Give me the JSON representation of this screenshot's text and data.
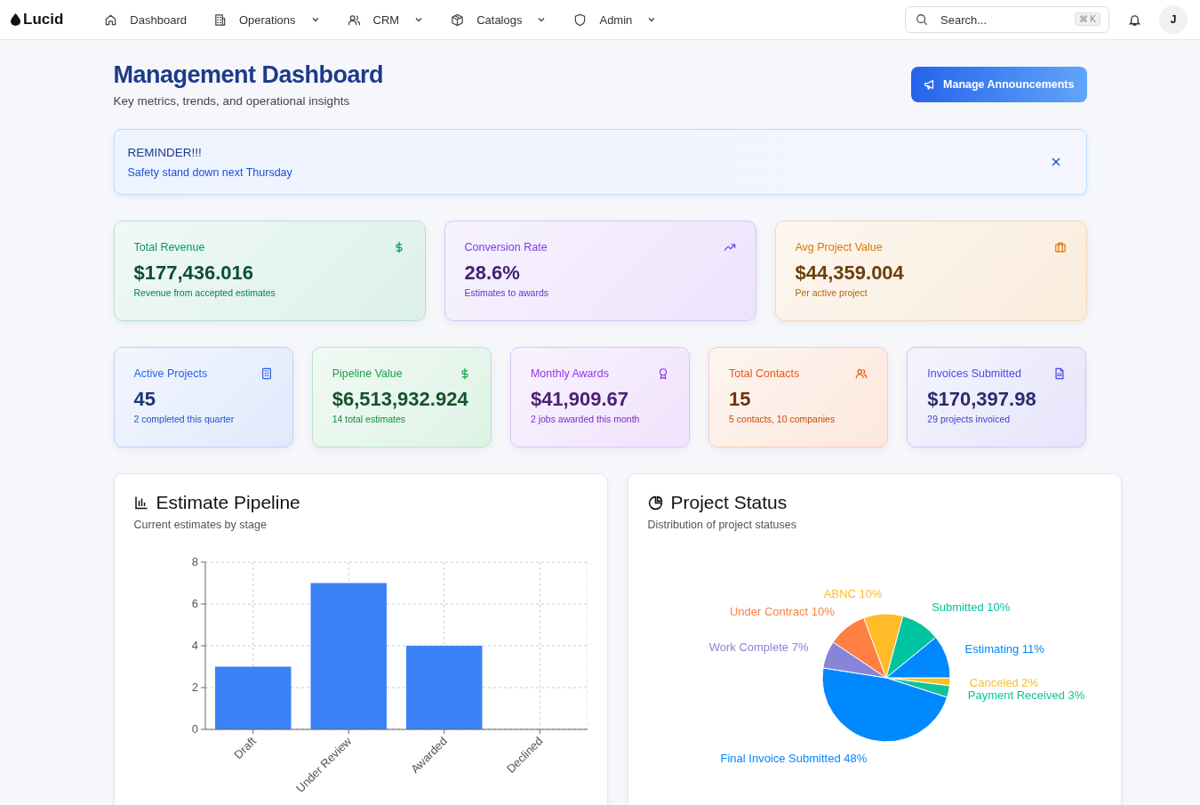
{
  "nav": {
    "logo": "Lucid",
    "items": [
      {
        "label": "Dashboard",
        "dropdown": false
      },
      {
        "label": "Operations",
        "dropdown": true
      },
      {
        "label": "CRM",
        "dropdown": true
      },
      {
        "label": "Catalogs",
        "dropdown": true
      },
      {
        "label": "Admin",
        "dropdown": true
      }
    ],
    "search": {
      "placeholder": "Search...",
      "shortcut": "⌘ K"
    },
    "avatar": "J"
  },
  "header": {
    "title": "Management Dashboard",
    "subtitle": "Key metrics, trends, and operational insights",
    "button": "Manage Announcements"
  },
  "announcement": {
    "title": "REMINDER!!!",
    "text": "Safety stand down next Thursday"
  },
  "top_cards": [
    {
      "title": "Total Revenue",
      "value": "$177,436.016",
      "note": "Revenue from accepted estimates",
      "color": "#059669"
    },
    {
      "title": "Conversion Rate",
      "value": "28.6%",
      "note": "Estimates to awards",
      "color": "#7c3aed"
    },
    {
      "title": "Avg Project Value",
      "value": "$44,359.004",
      "note": "Per active project",
      "color": "#d97706"
    }
  ],
  "cards": [
    {
      "title": "Active Projects",
      "value": "45",
      "note": "2 completed this quarter",
      "color": "#2563eb"
    },
    {
      "title": "Pipeline Value",
      "value": "$6,513,932.924",
      "note": "14 total estimates",
      "color": "#16a34a"
    },
    {
      "title": "Monthly Awards",
      "value": "$41,909.67",
      "note": "2 jobs awarded this month",
      "color": "#9333ea"
    },
    {
      "title": "Total Contacts",
      "value": "15",
      "note": "5 contacts, 10 companies",
      "color": "#ea580c"
    },
    {
      "title": "Invoices Submitted",
      "value": "$170,397.98",
      "note": "29 projects invoiced",
      "color": "#4f46e5"
    }
  ],
  "pipeline": {
    "title": "Estimate Pipeline",
    "subtitle": "Current estimates by stage",
    "chart_data": {
      "type": "bar",
      "categories": [
        "Draft",
        "Under Review",
        "Awarded",
        "Declined"
      ],
      "values": [
        3,
        7,
        4,
        0
      ],
      "color": "#3b82f6",
      "grid": true,
      "ylim": [
        0,
        8
      ],
      "yticks": [
        0,
        2,
        4,
        6,
        8
      ]
    }
  },
  "status": {
    "title": "Project Status",
    "subtitle": "Distribution of project statuses",
    "chart_data": {
      "type": "pie",
      "categories": [
        "Canceled",
        "Payment Received",
        "Final Invoice Submitted",
        "Work Complete",
        "Under Contract",
        "ABNC",
        "Submitted",
        "Estimating"
      ],
      "values": [
        2,
        3,
        48,
        7,
        10,
        10,
        10,
        11
      ],
      "colors": [
        "#fbbf24",
        "#10c398",
        "#0088fe",
        "#8884d8",
        "#ff8042",
        "#ffbb28",
        "#00c49f",
        "#0088fe"
      ],
      "value_labels": [
        "2%",
        "3%",
        "48%",
        "7%",
        "10%",
        "10%",
        "10%",
        "11%"
      ]
    }
  }
}
